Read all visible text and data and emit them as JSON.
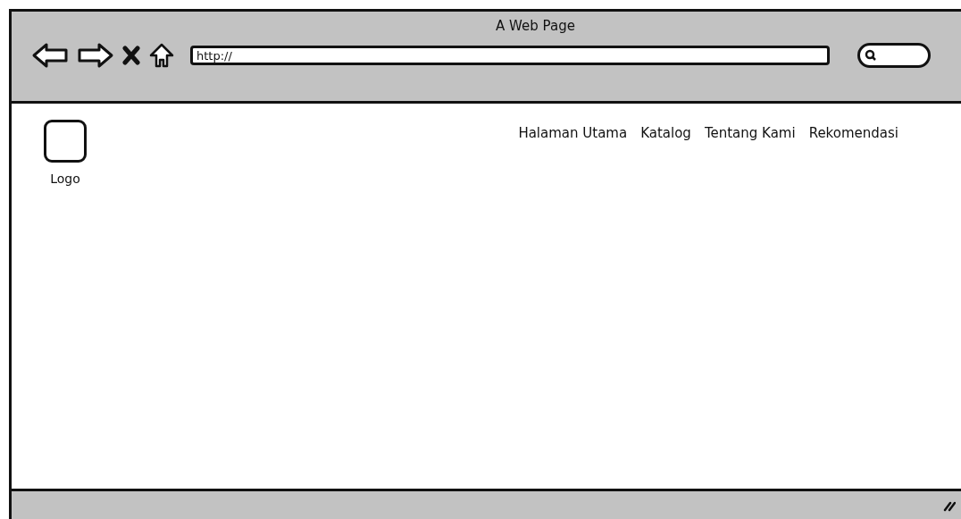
{
  "window": {
    "title": "A Web Page"
  },
  "address_bar": {
    "value": "http://"
  },
  "logo": {
    "label": "Logo"
  },
  "nav": [
    {
      "label": "Halaman Utama"
    },
    {
      "label": "Katalog"
    },
    {
      "label": "Tentang Kami"
    },
    {
      "label": "Rekomendasi"
    }
  ]
}
